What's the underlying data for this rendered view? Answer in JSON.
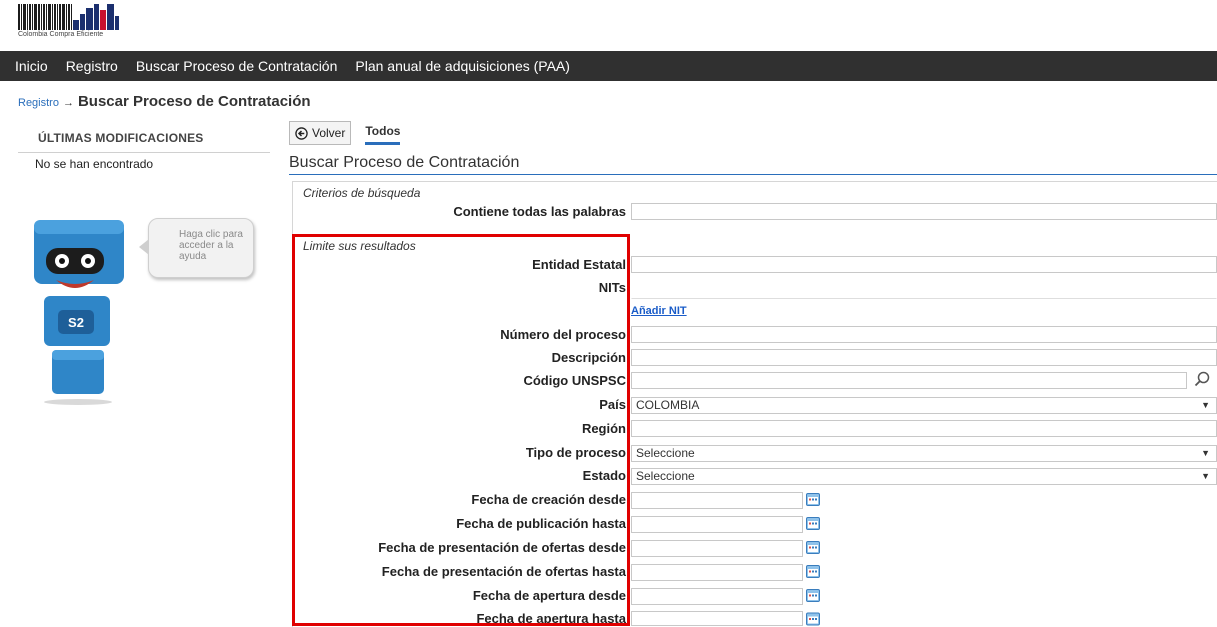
{
  "header": {
    "logo_text": "Colombia Compra Eficiente"
  },
  "nav": {
    "items": [
      {
        "label": "Inicio"
      },
      {
        "label": "Registro"
      },
      {
        "label": "Buscar Proceso de Contratación"
      },
      {
        "label": "Plan anual de adquisiciones (PAA)"
      }
    ]
  },
  "breadcrumb": {
    "link": "Registro",
    "arrow": "→",
    "title": "Buscar Proceso de Contratación"
  },
  "sidebar": {
    "title": "ÚLTIMAS MODIFICACIONES",
    "empty_text": "No se han encontrado",
    "help_bubble": "Haga clic para acceder a la ayuda",
    "mascot_label": "S2"
  },
  "toolbar": {
    "back_label": "Volver",
    "tab_label": "Todos"
  },
  "section_title": "Buscar Proceso de Contratación",
  "criteria": {
    "title": "Criterios de búsqueda",
    "keywords_label": "Contiene todas las palabras"
  },
  "filters": {
    "title": "Limite sus resultados",
    "entidad_label": "Entidad Estatal",
    "nits_label": "NITs",
    "add_nit": "Añadir NIT",
    "numero_label": "Número del proceso",
    "descripcion_label": "Descripción",
    "unspsc_label": "Código UNSPSC",
    "pais_label": "País",
    "pais_value": "COLOMBIA",
    "region_label": "Región",
    "tipo_label": "Tipo de proceso",
    "tipo_value": "Seleccione",
    "estado_label": "Estado",
    "estado_value": "Seleccione",
    "creacion_desde_label": "Fecha de creación desde",
    "publicacion_hasta_label": "Fecha de publicación hasta",
    "ofertas_desde_label": "Fecha de presentación de ofertas desde",
    "ofertas_hasta_label": "Fecha de presentación de ofertas hasta",
    "apertura_desde_label": "Fecha de apertura desde",
    "apertura_hasta_label": "Fecha de apertura hasta"
  },
  "colors": {
    "nav_bg": "#303030",
    "accent": "#2a6ebb",
    "highlight": "#e00000",
    "mascot": "#2f86c8"
  }
}
